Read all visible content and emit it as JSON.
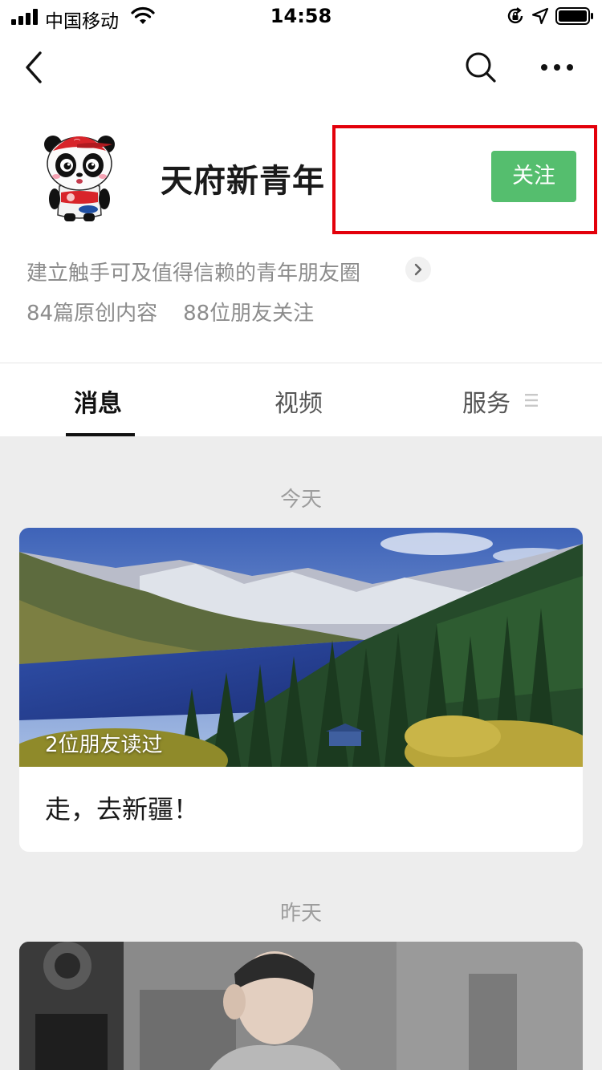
{
  "status_bar": {
    "carrier": "中国移动",
    "time": "14:58"
  },
  "account": {
    "name": "天府新青年",
    "follow_label": "关注",
    "description": "建立触手可及值得信赖的青年朋友圈",
    "original_count": "84篇原创内容",
    "friends_following": "88位朋友关注"
  },
  "tabs": [
    {
      "label": "消息",
      "active": true
    },
    {
      "label": "视频",
      "active": false
    },
    {
      "label": "服务",
      "active": false
    }
  ],
  "feed": {
    "groups": [
      {
        "date": "今天",
        "articles": [
          {
            "title": "走，去新疆！",
            "read_by": "2位朋友读过"
          }
        ]
      },
      {
        "date": "昨天",
        "articles": []
      }
    ]
  },
  "colors": {
    "follow_button": "#55be6e",
    "highlight_box": "#e3000b",
    "feed_background": "#ededed"
  }
}
